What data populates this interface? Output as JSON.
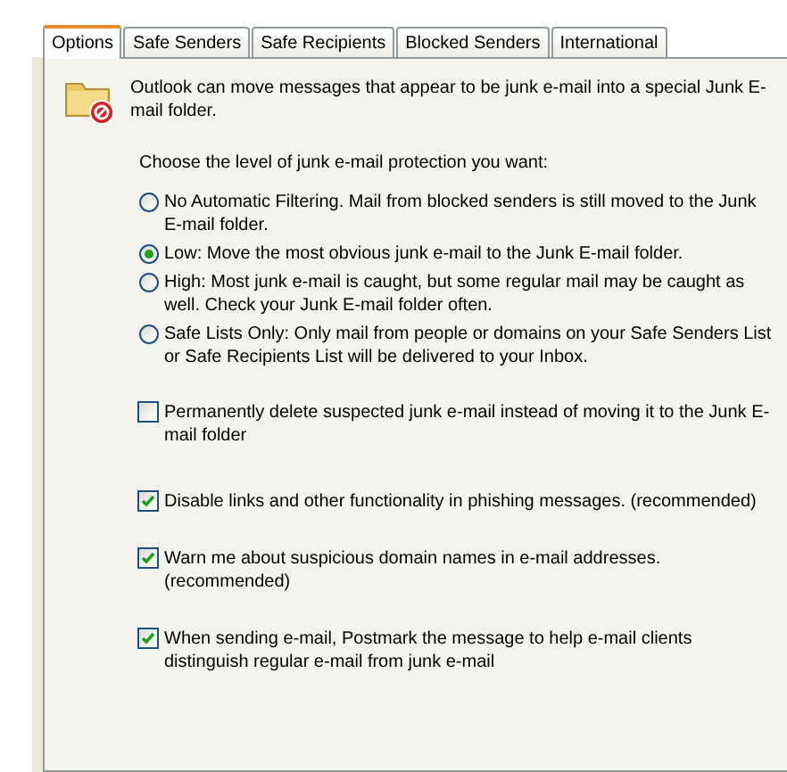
{
  "tabs": [
    {
      "label": "Options",
      "selected": true
    },
    {
      "label": "Safe Senders",
      "selected": false
    },
    {
      "label": "Safe Recipients",
      "selected": false
    },
    {
      "label": "Blocked Senders",
      "selected": false
    },
    {
      "label": "International",
      "selected": false
    }
  ],
  "intro": "Outlook can move messages that appear to be junk e-mail into a special Junk E-mail folder.",
  "prompt": "Choose the level of junk e-mail protection you want:",
  "levels": [
    {
      "label": "No Automatic Filtering. Mail from blocked senders is still moved to the Junk E-mail folder.",
      "selected": false
    },
    {
      "label": "Low: Move the most obvious junk e-mail to the Junk E-mail folder.",
      "selected": true
    },
    {
      "label": "High: Most junk e-mail is caught, but some regular mail may be caught as well. Check your Junk E-mail folder often.",
      "selected": false
    },
    {
      "label": "Safe Lists Only: Only mail from people or domains on your Safe Senders List or Safe Recipients List will be delivered to your Inbox.",
      "selected": false
    }
  ],
  "options": [
    {
      "label": "Permanently delete suspected junk e-mail instead of moving it to the Junk E-mail folder",
      "checked": false
    },
    {
      "label": "Disable links and other functionality in phishing messages. (recommended)",
      "checked": true
    },
    {
      "label": "Warn me about suspicious domain names in e-mail addresses. (recommended)",
      "checked": true
    },
    {
      "label": "When sending e-mail, Postmark the message to help e-mail clients distinguish regular e-mail from junk e-mail",
      "checked": true
    }
  ]
}
